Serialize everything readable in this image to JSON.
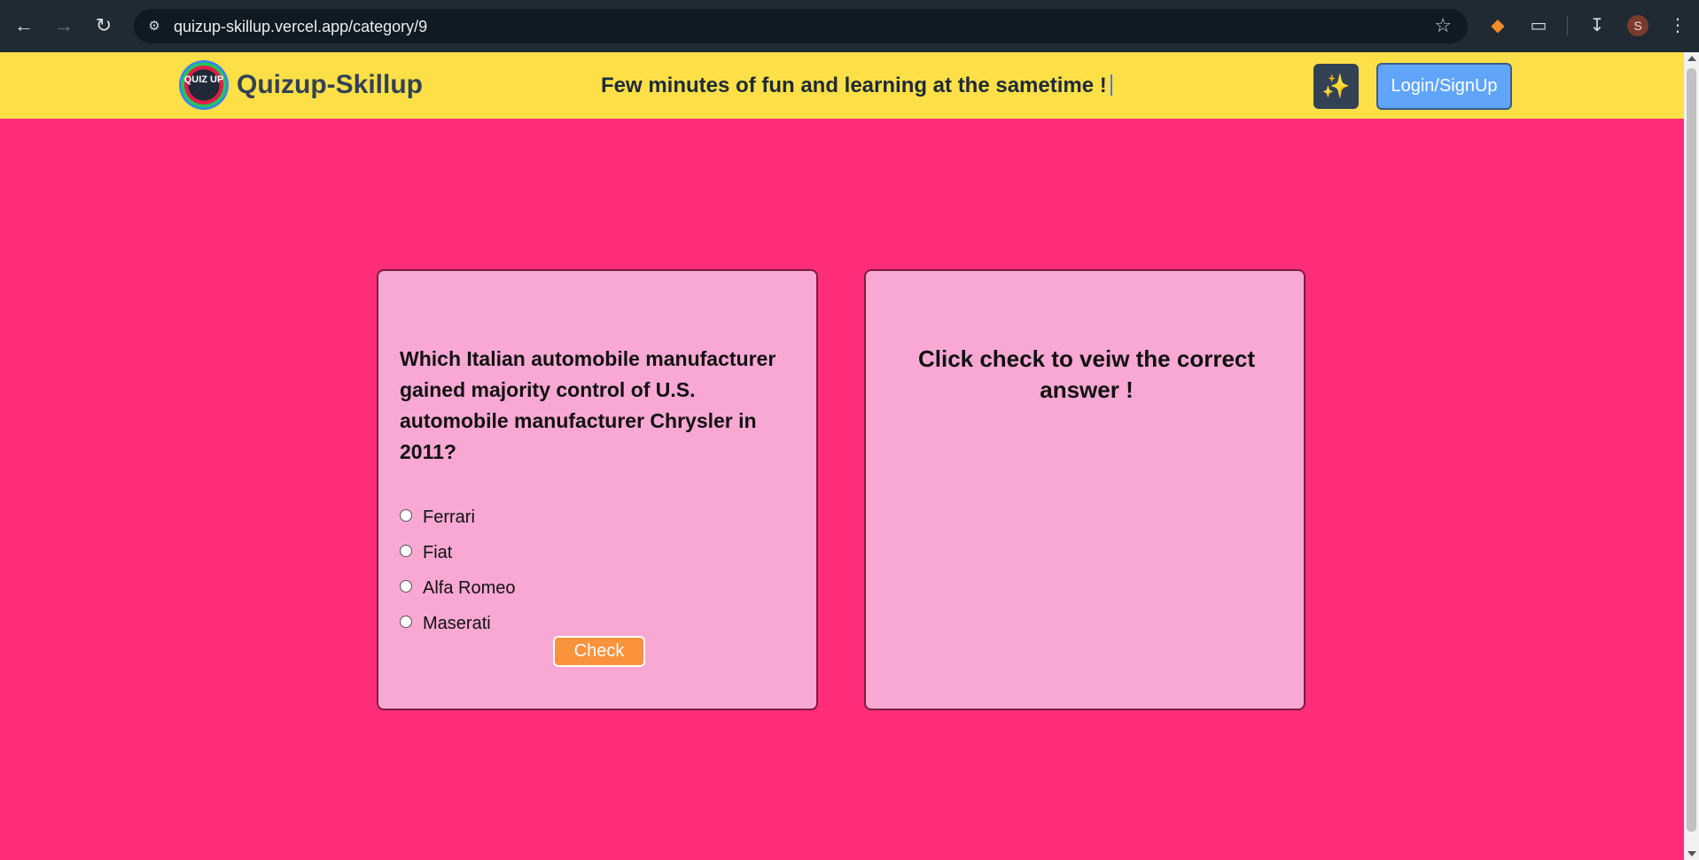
{
  "browser": {
    "url": "quizup-skillup.vercel.app/category/9",
    "avatar_letter": "S",
    "icons": [
      "back-icon",
      "forward-icon",
      "reload-icon",
      "site-settings-icon",
      "bookmark-star-icon",
      "metamask-fox-icon",
      "extensions-icon",
      "download-icon",
      "menu-dots-icon"
    ]
  },
  "header": {
    "logo_text": "QUIZ UP",
    "brand": "Quizup-Skillup",
    "tagline": "Few minutes of fun and learning at the sametime !",
    "login_label": "Login/SignUp",
    "colors": {
      "bar": "#fde047",
      "login": "#60a5fa",
      "spark_btn": "#334155"
    }
  },
  "quiz": {
    "question": "Which Italian automobile manufacturer gained majority control of U.S. automobile manufacturer Chrysler in 2011?",
    "options": [
      "Ferrari",
      "Fiat",
      "Alfa Romeo",
      "Maserati"
    ],
    "check_label": "Check",
    "answer_message": "Click check to veiw the correct answer !"
  },
  "colors": {
    "page_bg": "#ff2d7a",
    "card_bg": "#f9a8d4",
    "check_btn": "#fb923c"
  }
}
